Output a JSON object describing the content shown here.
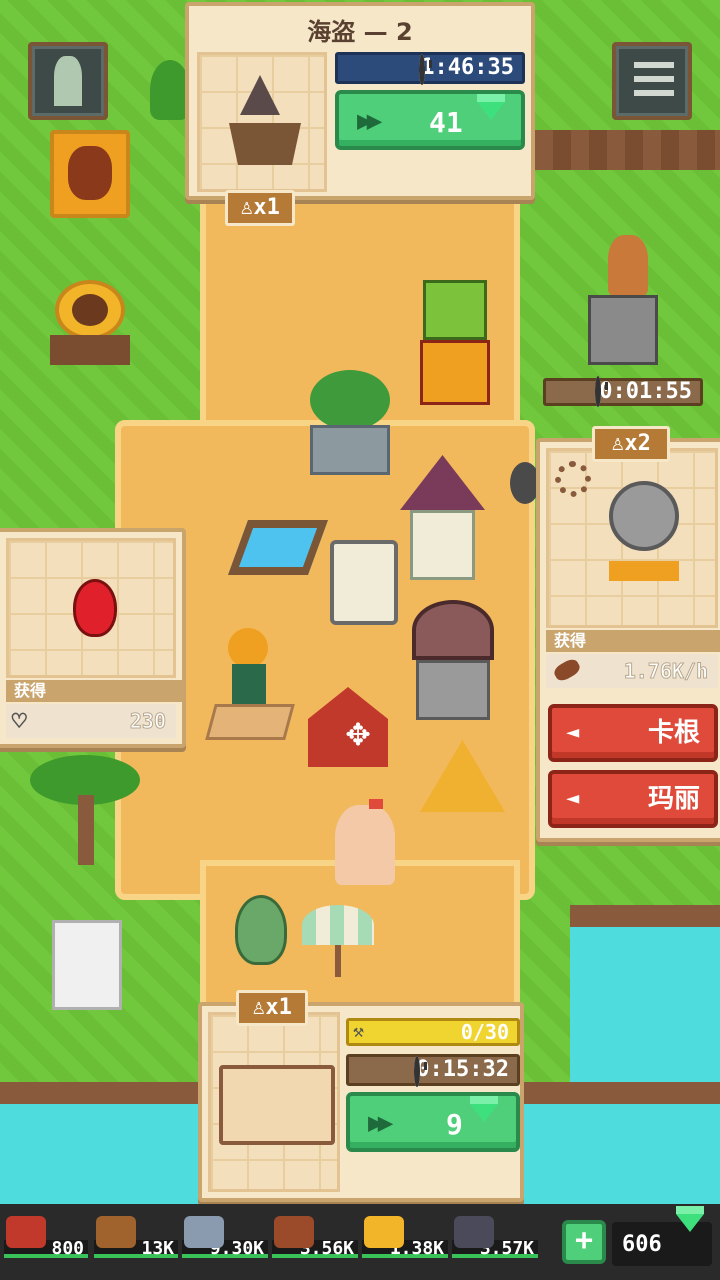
{
  "top_panel": {
    "title": "海盗 — 2",
    "timer": "1:46:35",
    "speedup_cost": "41",
    "workers": "x1"
  },
  "right_panel": {
    "workers": "x2",
    "obtain_label": "获得",
    "rate": "1.76K/h",
    "buttons": [
      "卡根",
      "玛丽"
    ]
  },
  "left_panel": {
    "obtain_label": "获得",
    "value": "230"
  },
  "floating_timer": "0:01:55",
  "bottom_panel": {
    "workers": "x1",
    "progress": "0/30",
    "timer": "0:15:32",
    "speedup_cost": "9"
  },
  "resources": [
    {
      "name": "meat",
      "value": "800",
      "color": "#c0392b"
    },
    {
      "name": "wood",
      "value": "13K",
      "color": "#a0632e"
    },
    {
      "name": "stone",
      "value": "9.30K",
      "color": "#8a9bb0"
    },
    {
      "name": "rope",
      "value": "3.56K",
      "color": "#9b4a2a"
    },
    {
      "name": "gold",
      "value": "1.38K",
      "color": "#f2b52a"
    },
    {
      "name": "ore",
      "value": "3.57K",
      "color": "#4a4a5a"
    }
  ],
  "gems": "606",
  "colors": {
    "accent_green": "#4fcf7a",
    "accent_red": "#e04a3a",
    "timer_blue": "#2c4a7a"
  }
}
